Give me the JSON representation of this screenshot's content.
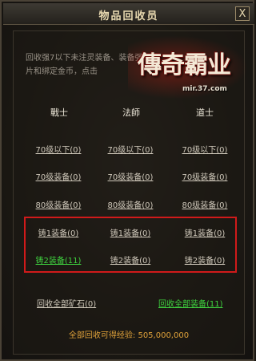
{
  "window": {
    "title": "物品回收员",
    "close_label": "X"
  },
  "description": {
    "line1": "回收强7以下未注灵装备、装备强化碎",
    "line2": "片和绑定金币，点击"
  },
  "logo": {
    "text": "傳奇霸业",
    "url": "mir.37.com"
  },
  "columns": [
    "戰士",
    "法師",
    "道士"
  ],
  "rows": [
    [
      "70级以下(0)",
      "70级以下(0)",
      "70级以下(0)"
    ],
    [
      "70级装备(0)",
      "70级装备(0)",
      "70级装备(0)"
    ],
    [
      "80级装备(0)",
      "80级装备(0)",
      "80级装备(0)"
    ],
    [
      "铸1装备(0)",
      "铸1装备(0)",
      "铸1装备(0)"
    ],
    [
      "铸2装备(11)",
      "铸2装备(0)",
      "铸2装备(0)"
    ]
  ],
  "actions": {
    "recycle_ore": "回收全部矿石(0)",
    "recycle_all_equipment": "回收全部装备(11)"
  },
  "total": "全部回收可得经验: 505,000,000",
  "colors": {
    "highlight_border": "#d01a1a",
    "green_text": "#3fd23f",
    "gold_text": "#e0a23a"
  }
}
